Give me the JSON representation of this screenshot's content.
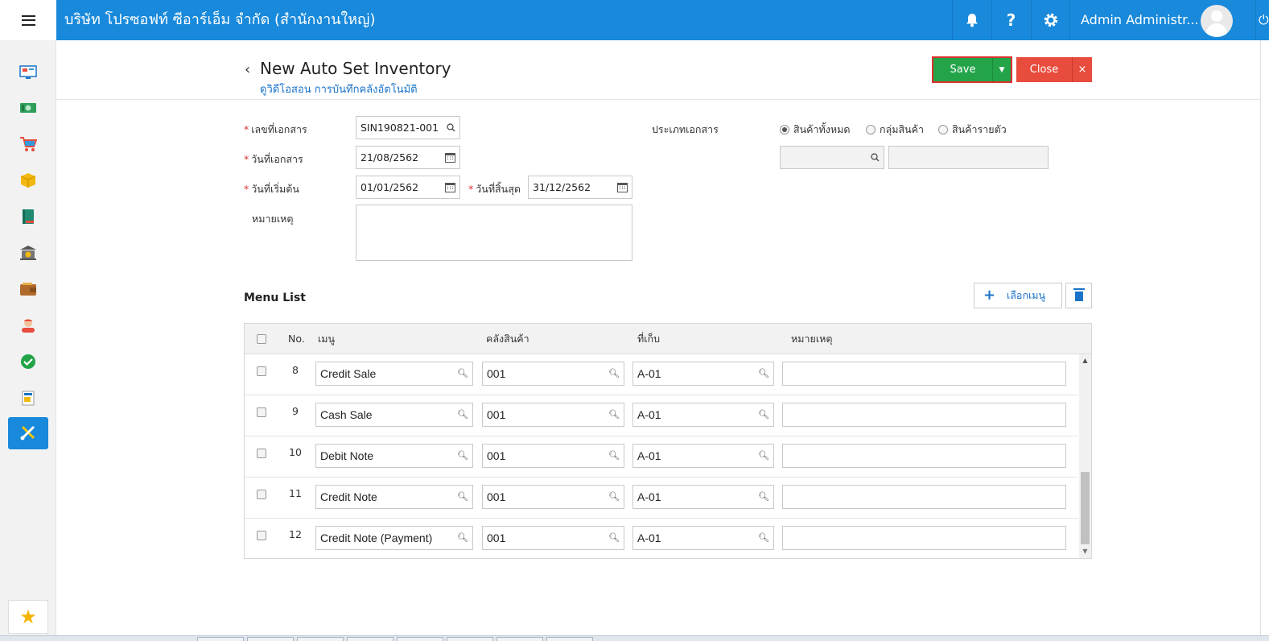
{
  "header": {
    "company": "บริษัท โปรซอฟท์ ซีอาร์เอ็ม จำกัด (สำนักงานใหญ่)",
    "help_label": "?",
    "user_name": "Admin Administr..."
  },
  "sidebar": {
    "icons": [
      "dashboard-icon",
      "money-icon",
      "cart-icon",
      "box-icon",
      "book-icon",
      "bank-icon",
      "wallet-icon",
      "contact-icon",
      "check-icon",
      "report-icon",
      "tools-icon"
    ],
    "active_index": 10,
    "favorite_icon": "star-icon"
  },
  "page": {
    "title": "New Auto Set Inventory",
    "subtitle": "ดูวิดีโอสอน การบันทึกคลังอัตโนมัติ",
    "save_label": "Save",
    "close_label": "Close",
    "close_x": "×"
  },
  "form": {
    "doc_no_label": "เลขที่เอกสาร",
    "doc_no_value": "SIN190821-001",
    "doc_date_label": "วันที่เอกสาร",
    "doc_date_value": "21/08/2562",
    "start_date_label": "วันที่เริ่มต้น",
    "start_date_value": "01/01/2562",
    "end_date_label": "วันที่สิ้นสุด",
    "end_date_value": "31/12/2562",
    "remark_label": "หมายเหตุ",
    "doc_type_label": "ประเภทเอกสาร",
    "doc_type_options": [
      "สินค้าทั้งหมด",
      "กลุ่มสินค้า",
      "สินค้ารายตัว"
    ],
    "doc_type_selected": 0
  },
  "menu_list": {
    "title": "Menu List",
    "select_button": "เลือกเมนู",
    "columns": {
      "no": "No.",
      "menu": "เมนู",
      "warehouse": "คลังสินค้า",
      "location": "ที่เก็บ",
      "remark": "หมายเหตุ"
    },
    "rows": [
      {
        "no": "8",
        "menu": "Credit Sale",
        "warehouse": "001",
        "location": "A-01",
        "remark": ""
      },
      {
        "no": "9",
        "menu": "Cash Sale",
        "warehouse": "001",
        "location": "A-01",
        "remark": ""
      },
      {
        "no": "10",
        "menu": "Debit Note",
        "warehouse": "001",
        "location": "A-01",
        "remark": ""
      },
      {
        "no": "11",
        "menu": "Credit Note",
        "warehouse": "001",
        "location": "A-01",
        "remark": ""
      },
      {
        "no": "12",
        "menu": "Credit Note (Payment)",
        "warehouse": "001",
        "location": "A-01",
        "remark": ""
      }
    ]
  },
  "colors": {
    "header_blue": "#1889db",
    "save_green": "#23a449",
    "close_red": "#e84c3d",
    "link_blue": "#1a73c8"
  }
}
